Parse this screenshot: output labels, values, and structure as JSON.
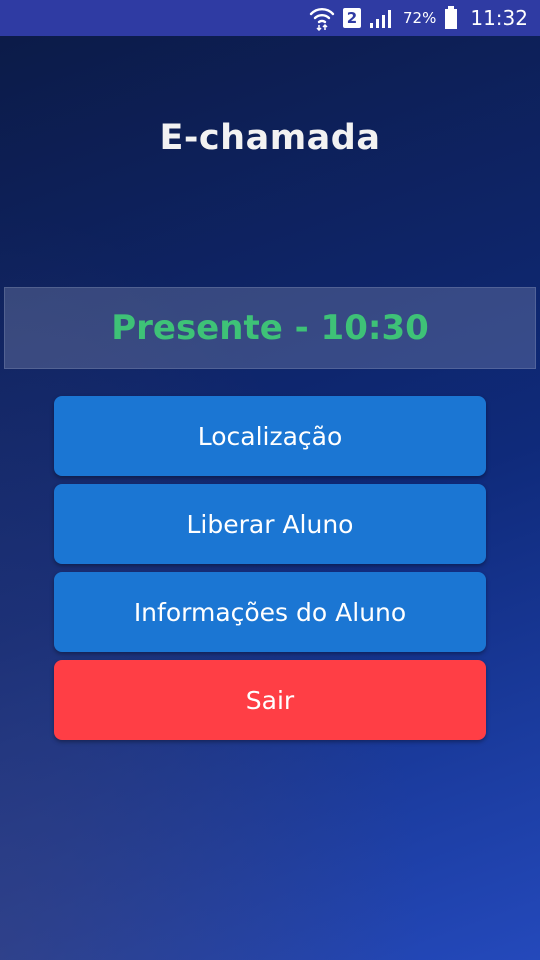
{
  "status_bar": {
    "sim_slot": "2",
    "battery_percent": "72%",
    "time": "11:32",
    "icons": [
      "wifi-icon",
      "sim-badge",
      "signal-icon",
      "battery-icon"
    ]
  },
  "app": {
    "title": "E-chamada"
  },
  "attendance": {
    "status": "Presente - 10:30",
    "status_color": "#3ec277"
  },
  "buttons": {
    "location": "Localização",
    "release_student": "Liberar Aluno",
    "student_info": "Informações do Aluno",
    "exit": "Sair"
  },
  "colors": {
    "status_bar": "#2f3ba3",
    "primary_button": "#1b76d3",
    "exit_button": "#ff3e45"
  }
}
